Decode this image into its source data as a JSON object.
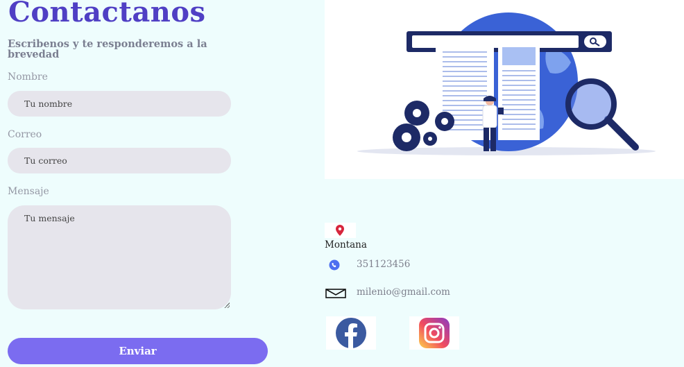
{
  "form": {
    "title": "Contactanos",
    "subtitle": "Escribenos y te responderemos a la brevedad",
    "name_label": "Nombre",
    "name_placeholder": "Tu nombre",
    "email_label": "Correo",
    "email_placeholder": "Tu correo",
    "message_label": "Mensaje",
    "message_placeholder": "Tu mensaje",
    "submit_label": "Enviar"
  },
  "contact": {
    "location": "Montana",
    "phone": "351123456",
    "email": "milenio@gmail.com"
  },
  "icons": {
    "location": "location-pin-icon",
    "phone": "phone-icon",
    "email": "envelope-icon",
    "facebook": "facebook-icon",
    "instagram": "instagram-icon"
  },
  "colors": {
    "accent": "#4f3fc4",
    "button": "#7b6cf0",
    "background": "#eefdfd"
  }
}
